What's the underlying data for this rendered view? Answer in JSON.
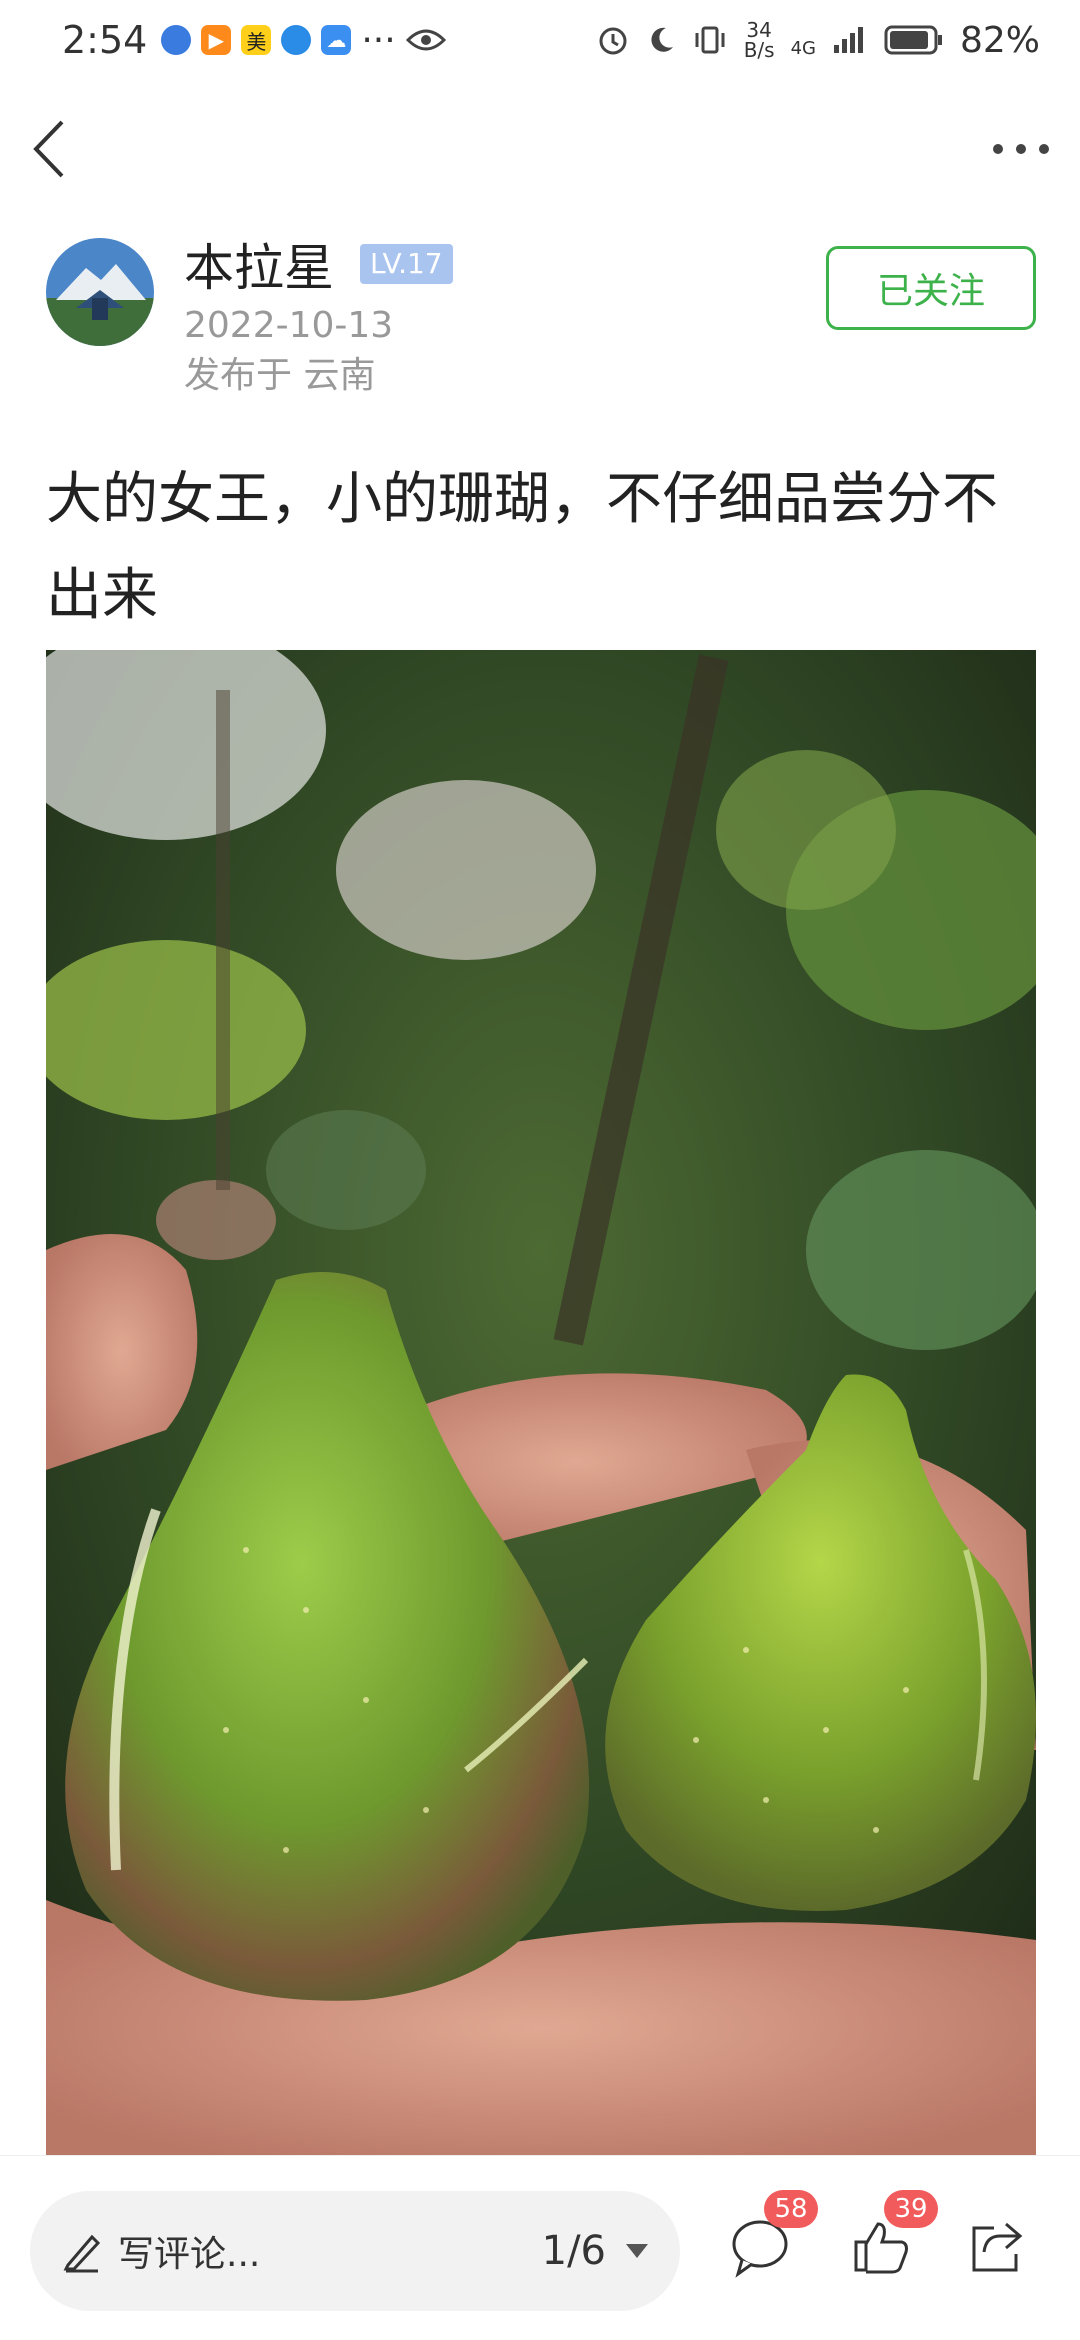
{
  "status_bar": {
    "time": "2:54",
    "app_icon_meituan": "美",
    "overflow": "···",
    "net_speed_value": "34",
    "net_speed_unit": "B/s",
    "network": "4G",
    "battery": "82%"
  },
  "author": {
    "name": "本拉星",
    "level": "LV.17",
    "date": "2022-10-13",
    "location": "发布于 云南",
    "follow_label": "已关注"
  },
  "post": {
    "title": "大的女王，小的珊瑚，不仔细品尝分不出来",
    "image_alt": "two green figs held in a hand"
  },
  "bottom": {
    "comment_placeholder": "写评论...",
    "page_indicator": "1/6",
    "comment_count": "58",
    "like_count": "39"
  },
  "colors": {
    "accent_green": "#3db24a",
    "badge_red": "#f15b5b",
    "level_blue": "#a9c4ee"
  }
}
